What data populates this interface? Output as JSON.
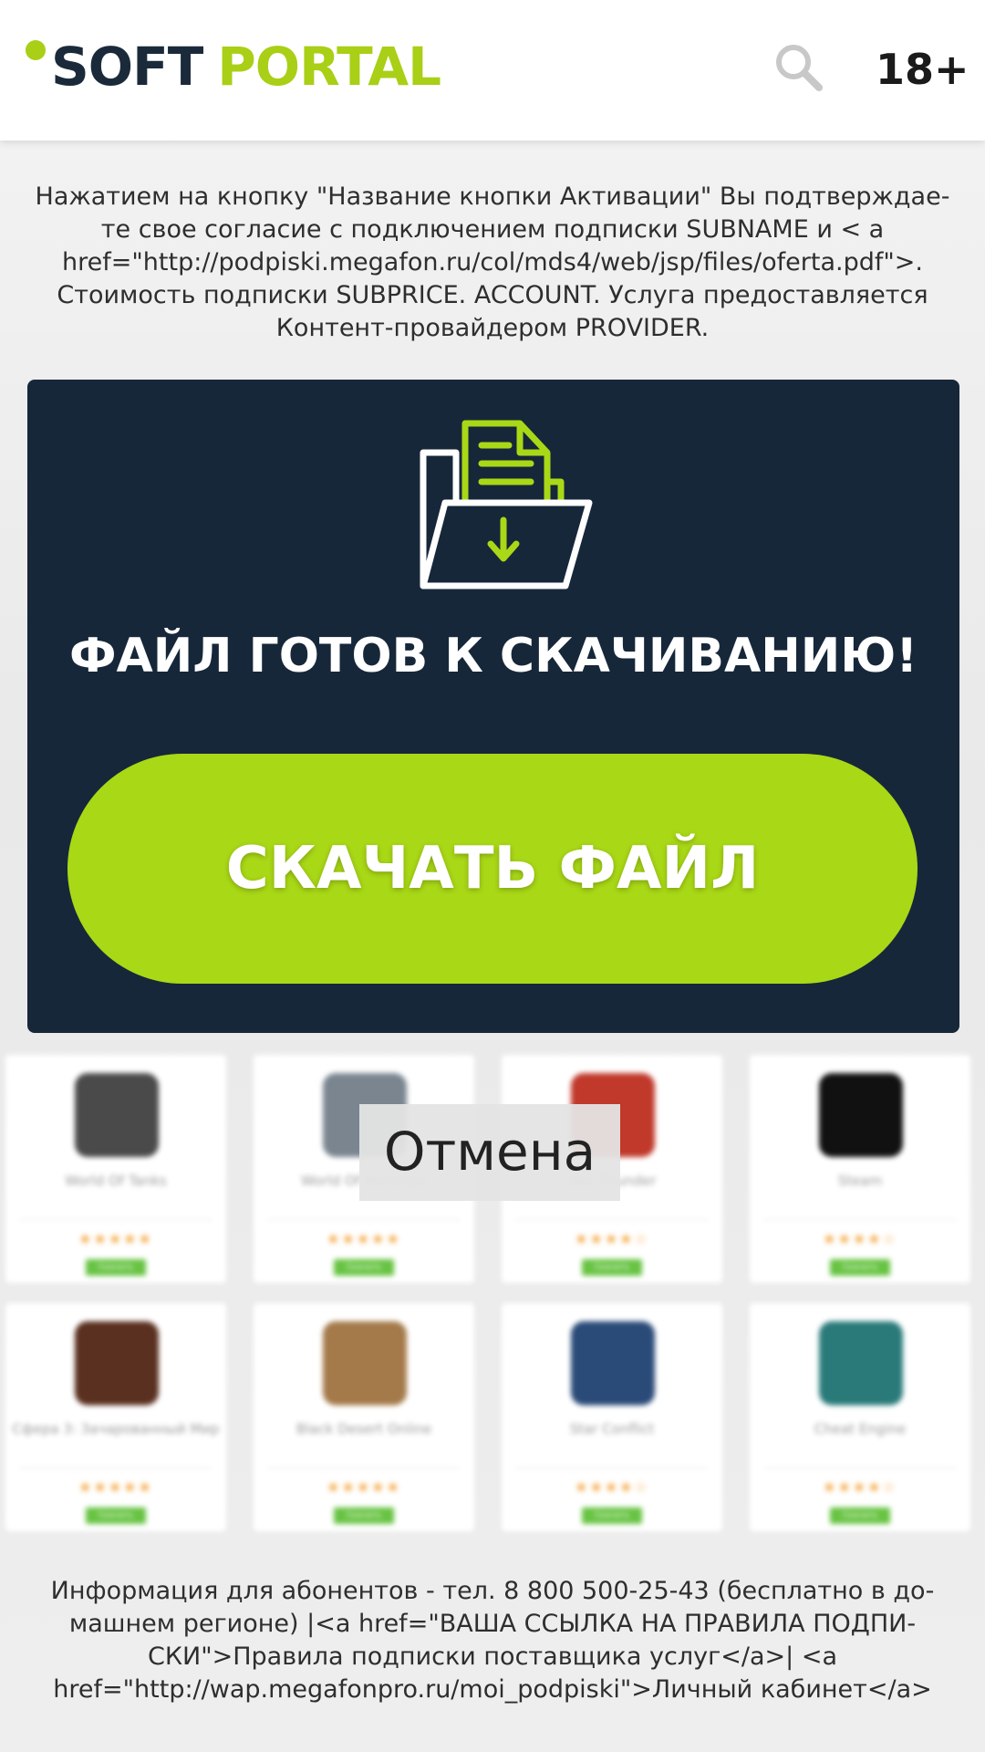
{
  "header": {
    "logo_soft": "SOFT",
    "logo_portal": "PORTAL",
    "age_rating": "18+",
    "icons": {
      "search": "search-icon"
    }
  },
  "disclaimer_top": "Нажатием на кнопку \"Название кнопки Активации\" Вы подтверждае-те свое согласие с подключением подписки SUBNAME и < a href=\"http://podpiski.megafon.ru/col/mds4/web/jsp/files/oferta.pdf\">. Стоимость подписки SUBPRICE. ACCOUNT. Услуга предоставляется Контент-провайдером PROVIDER.",
  "download_card": {
    "icon": "folder-download-icon",
    "title": "ФАЙЛ ГОТОВ К СКАЧИВАНИЮ!",
    "button_label": "СКАЧАТЬ ФАЙЛ"
  },
  "cancel_label": "Отмена",
  "apps": [
    {
      "name": "World Of Tanks",
      "rating": "★★★★★",
      "download_label": "Скачать",
      "icon_color": "#4a4a4a"
    },
    {
      "name": "World Of Warships",
      "rating": "★★★★★",
      "download_label": "Скачать",
      "icon_color": "#7a8590"
    },
    {
      "name": "War Thunder",
      "rating": "★★★★☆",
      "download_label": "Скачать",
      "icon_color": "#c0392b"
    },
    {
      "name": "Steam",
      "rating": "★★★★☆",
      "download_label": "Скачать",
      "icon_color": "#111111"
    },
    {
      "name": "Сфера 3: Зачарованный Мир",
      "rating": "★★★★★",
      "download_label": "Скачать",
      "icon_color": "#5a3020"
    },
    {
      "name": "Black Desert Online",
      "rating": "★★★★★",
      "download_label": "Скачать",
      "icon_color": "#a47a4a"
    },
    {
      "name": "Star Conflict",
      "rating": "★★★★☆",
      "download_label": "Скачать",
      "icon_color": "#2a4a78"
    },
    {
      "name": "Cheat Engine",
      "rating": "★★★★☆",
      "download_label": "Скачать",
      "icon_color": "#2a7a7a"
    }
  ],
  "footer_info": "Информация для абонентов - тел. 8 800 500-25-43 (бесплатно в до-машнем регионе) |<a href=\"ВАША ССЫЛКА НА ПРАВИЛА ПОДПИ-СКИ\">Правила подписки поставщика услуг</a>| <a href=\"http://wap.megafonpro.ru/moi_podpiski\">Личный кабинет</a>",
  "colors": {
    "brand_green": "#a9cf16",
    "brand_navy": "#1b2a3a",
    "card_bg": "#17273a",
    "button_green": "#a9d816"
  }
}
